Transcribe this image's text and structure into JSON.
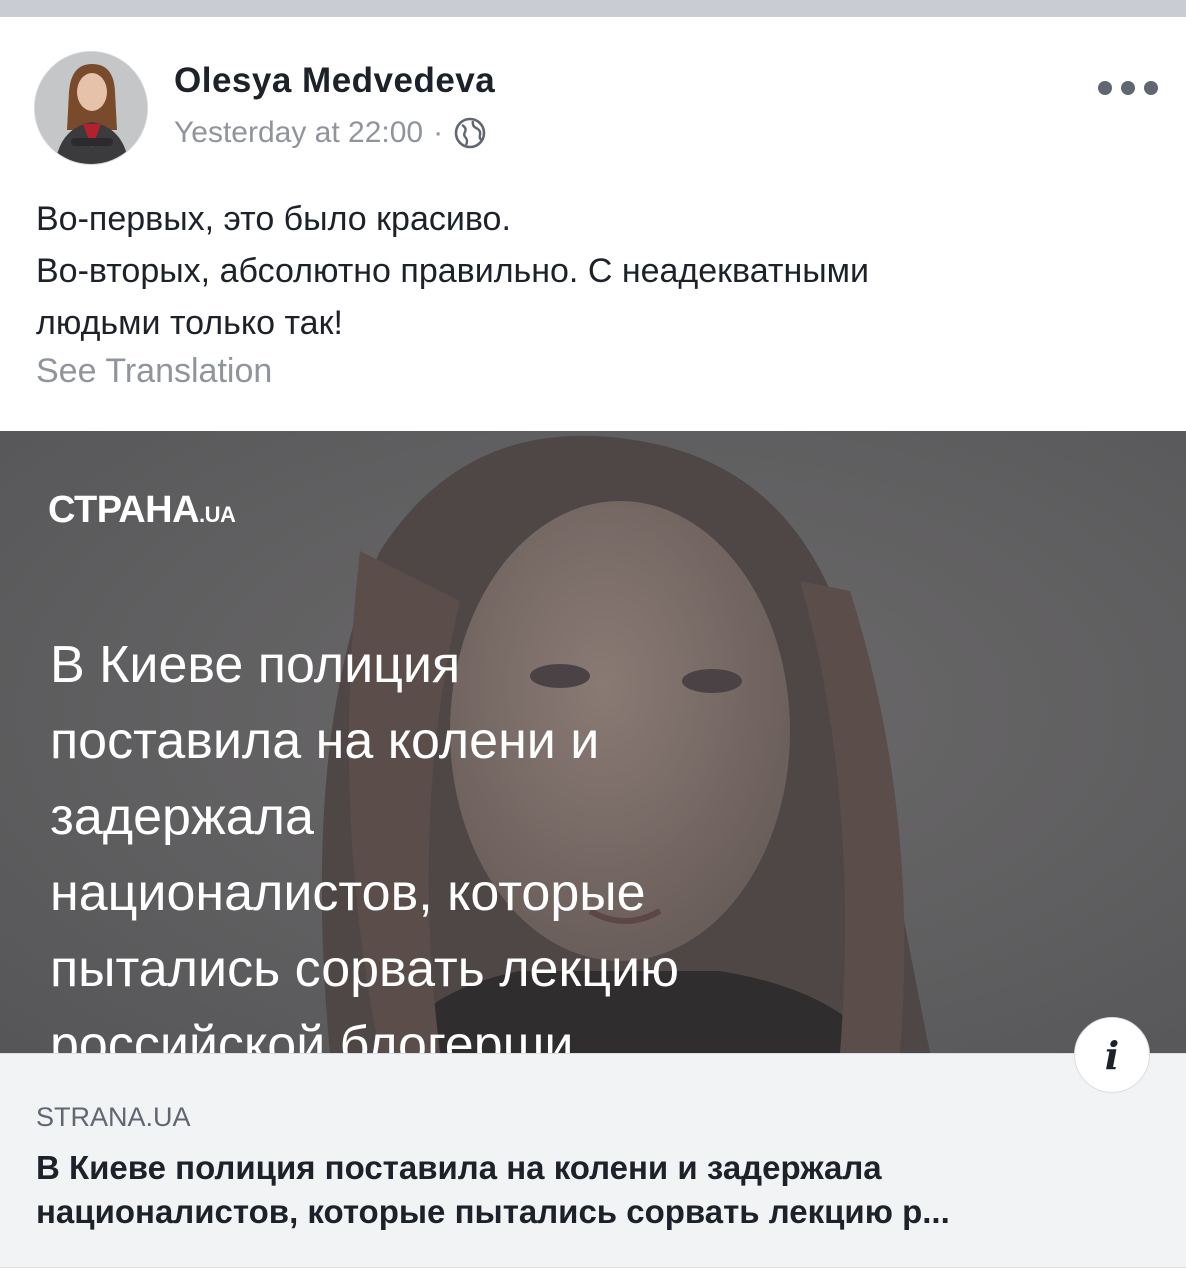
{
  "post": {
    "author": "Olesya  Medvedeva",
    "timestamp": "Yesterday at 22:00",
    "separator": "·",
    "privacy_icon": "globe-icon",
    "more_icon": "more-options-icon",
    "text_lines": [
      "Во-первых, это было красиво.",
      "Во-вторых, абсолютно правильно. С неадекватными",
      "людьми только так!"
    ],
    "see_translation": "See Translation"
  },
  "link_preview": {
    "image": {
      "brand_main": "СТРАНА",
      "brand_suffix": ".UA",
      "headline_lines": [
        "В Киеве полиция",
        "поставила на колени и",
        "задержала",
        "националистов, которые",
        "пытались сорвать лекцию",
        "российской блогерши"
      ]
    },
    "info_icon": "i",
    "domain": "STRANA.UA",
    "title_lines": [
      "В Киеве полиция поставила на колени и задержала",
      "националистов, которые пытались сорвать лекцию р..."
    ]
  },
  "colors": {
    "author": "#1d2129",
    "meta": "#90949c",
    "footer_bg": "#f2f3f5",
    "image_bg": "#5d5d60"
  }
}
